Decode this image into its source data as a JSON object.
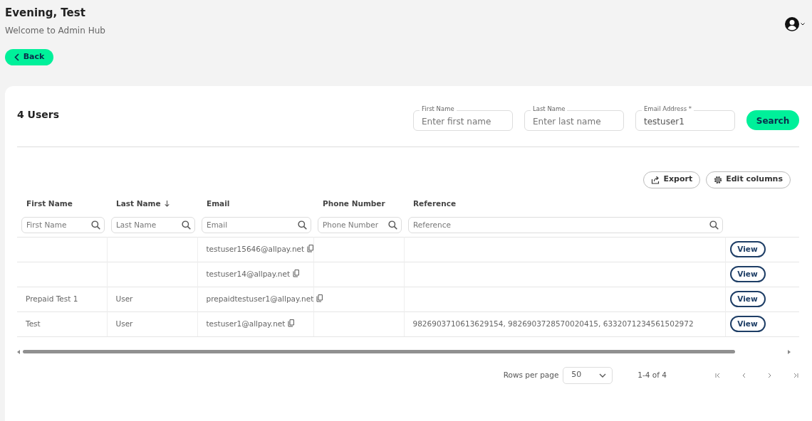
{
  "header": {
    "greeting": "Evening, Test",
    "subtitle": "Welcome to Admin Hub"
  },
  "back_button": "Back",
  "card": {
    "title": "4 Users",
    "search_fields": [
      {
        "label": "First Name",
        "placeholder": "Enter first name"
      },
      {
        "label": "Last Name",
        "placeholder": "Enter last name"
      },
      {
        "label": "Email Address *",
        "value": "testuser1"
      }
    ],
    "search_button": "Search",
    "actions": [
      {
        "kind": "export",
        "label": "Export"
      },
      {
        "kind": "columns",
        "label": "Edit columns"
      }
    ],
    "table": {
      "columns": [
        {
          "label": "First Name",
          "sorted": false,
          "filter_placeholder": "First Name"
        },
        {
          "label": "Last Name",
          "sorted": true,
          "filter_placeholder": "Last Name"
        },
        {
          "label": "Email",
          "sorted": false,
          "filter_placeholder": "Email"
        },
        {
          "label": "Phone Number",
          "sorted": false,
          "filter_placeholder": "Phone Number"
        },
        {
          "label": "Reference",
          "sorted": false,
          "filter_placeholder": "Reference"
        }
      ],
      "rows": [
        {
          "first_name": "",
          "last_name": "",
          "email": "testuser15646@allpay.net",
          "phone": "",
          "reference": "",
          "action": "View"
        },
        {
          "first_name": "",
          "last_name": "",
          "email": "testuser14@allpay.net",
          "phone": "",
          "reference": "",
          "action": "View"
        },
        {
          "first_name": "Prepaid Test 1",
          "last_name": "User",
          "email": "prepaidtestuser1@allpay.net",
          "phone": "",
          "reference": "",
          "action": "View"
        },
        {
          "first_name": "Test",
          "last_name": "User",
          "email": "testuser1@allpay.net",
          "phone": "",
          "reference": "9826903710613629154, 9826903728570020415, 6332071234561502972",
          "action": "View"
        }
      ]
    },
    "pagination": {
      "rows_per_page_label": "Rows per page",
      "rows_per_page": "50",
      "range": "1-4 of 4"
    }
  }
}
